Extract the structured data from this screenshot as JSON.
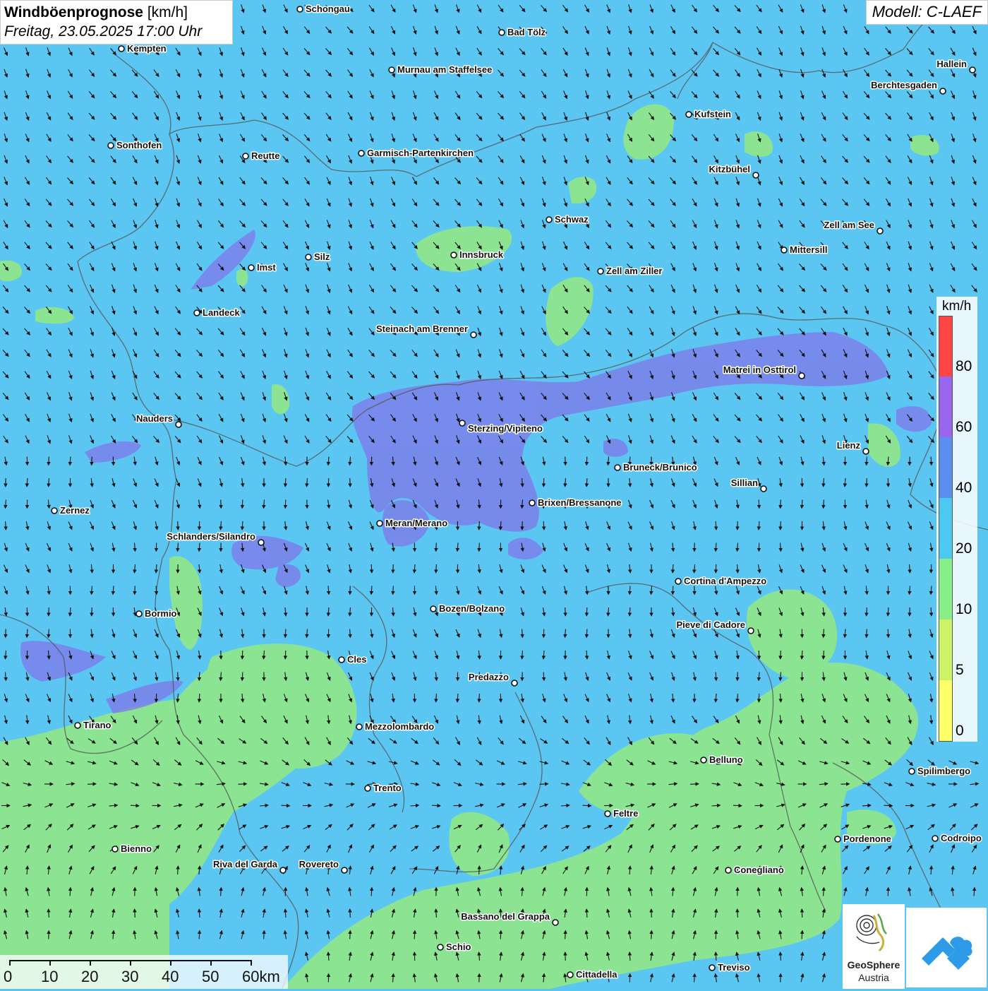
{
  "header": {
    "title_bold": "Windböenprognose",
    "title_unit": "[km/h]",
    "datetime": "Freitag, 23.05.2025 17:00 Uhr",
    "model": "Modell: C-LAEF"
  },
  "legend": {
    "unit": "km/h",
    "classes": [
      {
        "label": "0",
        "color": "#ffff66"
      },
      {
        "label": "5",
        "color": "#ccf266"
      },
      {
        "label": "10",
        "color": "#88ee88"
      },
      {
        "label": "20",
        "color": "#4cc9f0"
      },
      {
        "label": "40",
        "color": "#5b8ef0"
      },
      {
        "label": "60",
        "color": "#9966ee"
      },
      {
        "label": "80",
        "color": "#ff4444"
      }
    ]
  },
  "scale_bar": {
    "labels": [
      "0",
      "10",
      "20",
      "30",
      "40",
      "50",
      "60km"
    ]
  },
  "logos": {
    "geosphere": "GeoSphere",
    "geosphere_sub": "Austria"
  },
  "cities": [
    {
      "name": "Schongau"
    },
    {
      "name": "Bad Tölz"
    },
    {
      "name": "Kempten"
    },
    {
      "name": "Murnau am Staffelsee"
    },
    {
      "name": "Hallein"
    },
    {
      "name": "Berchtesgaden"
    },
    {
      "name": "Kufstein"
    },
    {
      "name": "Sonthofen"
    },
    {
      "name": "Reutte"
    },
    {
      "name": "Garmisch-Partenkirchen"
    },
    {
      "name": "Kitzbühel"
    },
    {
      "name": "Schwaz"
    },
    {
      "name": "Zell am See"
    },
    {
      "name": "Silz"
    },
    {
      "name": "Innsbruck"
    },
    {
      "name": "Mittersill"
    },
    {
      "name": "Imst"
    },
    {
      "name": "Zell am Ziller"
    },
    {
      "name": "Landeck"
    },
    {
      "name": "Steinach am Brenner"
    },
    {
      "name": "Matrei in Osttirol"
    },
    {
      "name": "Nauders"
    },
    {
      "name": "Sterzing/Vipiteno"
    },
    {
      "name": "Lienz"
    },
    {
      "name": "Bruneck/Brunico"
    },
    {
      "name": "Sillian"
    },
    {
      "name": "Zernez"
    },
    {
      "name": "Brixen/Bressanone"
    },
    {
      "name": "Meran/Merano"
    },
    {
      "name": "Schlanders/Silandro"
    },
    {
      "name": "Cortina d'Ampezzo"
    },
    {
      "name": "Bozen/Bolzano"
    },
    {
      "name": "Bormio"
    },
    {
      "name": "Pieve di Cadore"
    },
    {
      "name": "Cles"
    },
    {
      "name": "Predazzo"
    },
    {
      "name": "Tirano"
    },
    {
      "name": "Mezzolombardo"
    },
    {
      "name": "Belluno"
    },
    {
      "name": "Spilimbergo"
    },
    {
      "name": "Trento"
    },
    {
      "name": "Feltre"
    },
    {
      "name": "Pordenone"
    },
    {
      "name": "Codroipo"
    },
    {
      "name": "Bienno"
    },
    {
      "name": "Riva del Garda"
    },
    {
      "name": "Rovereto"
    },
    {
      "name": "Conegliano"
    },
    {
      "name": "Bassano del Grappa"
    },
    {
      "name": "Schio"
    },
    {
      "name": "Treviso"
    },
    {
      "name": "Cittadella"
    }
  ]
}
